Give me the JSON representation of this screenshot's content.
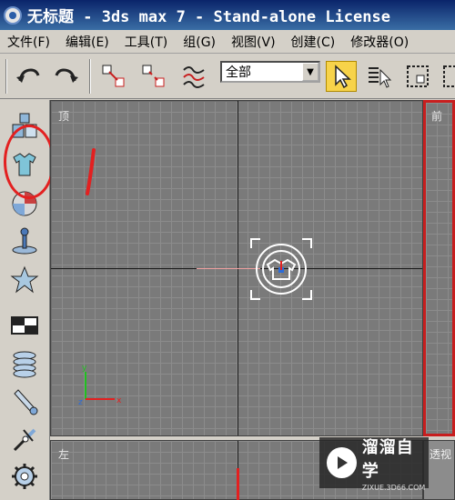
{
  "window": {
    "title": "无标题  - 3ds max 7  - Stand-alone License"
  },
  "menubar": {
    "items": [
      "文件(F)",
      "编辑(E)",
      "工具(T)",
      "组(G)",
      "视图(V)",
      "创建(C)",
      "修改器(O)"
    ]
  },
  "toolbar": {
    "selection_filter": "全部"
  },
  "viewports": {
    "top_label": "顶",
    "front_label": "前",
    "left_label": "左",
    "persp_label": "透视"
  },
  "watermark": {
    "brand": "溜溜自学",
    "url": "ZIXUE.3D66.COM"
  },
  "colors": {
    "annotation": "#e32020",
    "selection_highlight": "#f7d34a",
    "active_viewport_border": "#c81e1e"
  },
  "left_panel": {
    "icons": [
      "create-icon",
      "modify-icon",
      "hierarchy-icon",
      "motion-icon",
      "display-icon",
      "utilities-icon",
      "layer-icon",
      "cylinder-icon",
      "wrench-icon",
      "bone-icon",
      "gear-icon"
    ]
  }
}
